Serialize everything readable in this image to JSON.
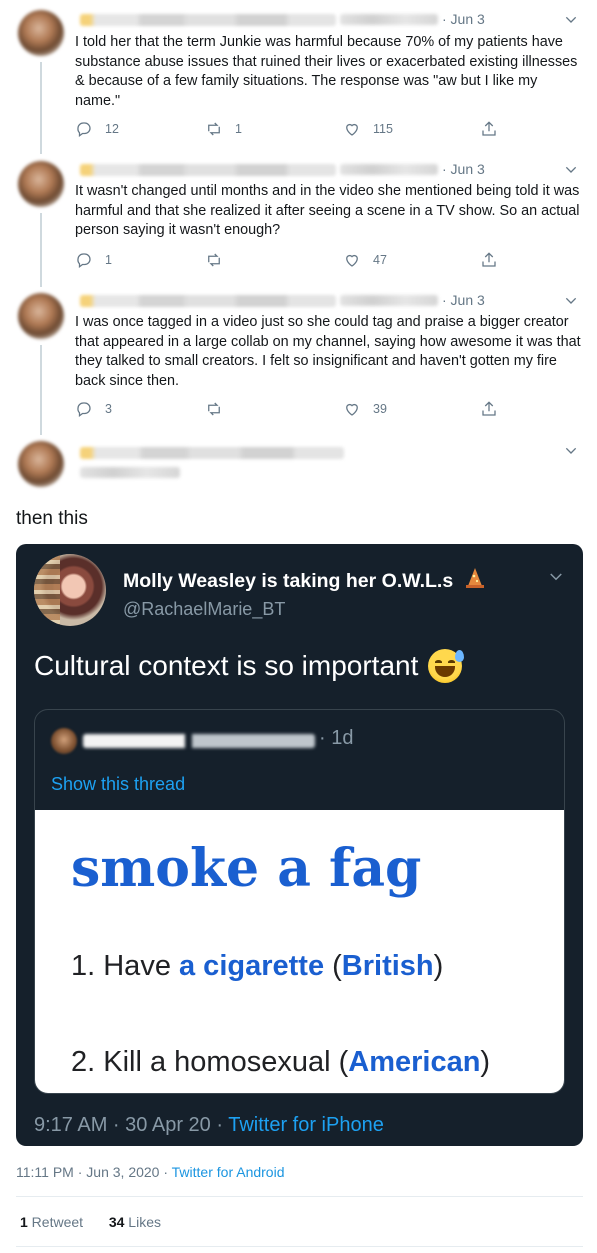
{
  "replies": [
    {
      "date": "· Jun 3",
      "text": "I told her that the term Junkie was harmful because 70% of my patients have substance abuse issues that ruined their lives or exacerbated existing illnesses & because of a few family situations. The response was \"aw but I like my name.\"",
      "replies": "12",
      "retweets": "1",
      "likes": "115"
    },
    {
      "date": "· Jun 3",
      "text": "It wasn't changed until months and in the video she mentioned being told it was harmful and that she realized it after seeing a scene in a TV show. So an actual person saying it wasn't enough?",
      "replies": "1",
      "retweets": "",
      "likes": "47"
    },
    {
      "date": "· Jun 3",
      "text": "I was once tagged in a video just so she could tag and praise a bigger creator that appeared in a large collab on my channel, saying how awesome it was that they talked to small creators. I felt so insignificant and haven't gotten my fire back since then.",
      "replies": "3",
      "retweets": "",
      "likes": "39"
    }
  ],
  "main_text": "then this",
  "embed": {
    "name": "Molly Weasley is taking her O.W.L.s",
    "handle": "@RachaelMarie_BT",
    "text": "Cultural context is so important",
    "quote": {
      "date": "· 1d",
      "show_thread": "Show this thread",
      "image": {
        "title": "smoke a fag",
        "def1_prefix": "1. Have ",
        "def1_bold": "a cigarette",
        "def1_mid": " (",
        "def1_region": "British",
        "def1_end": ")",
        "def2_prefix": "2. Kill a homosexual (",
        "def2_region": "American",
        "def2_end": ")"
      }
    },
    "footer_time": "9:17 AM · 30 Apr 20 · ",
    "footer_source": "Twitter for iPhone"
  },
  "meta": {
    "time": "11:11 PM · Jun 3, 2020 · ",
    "source": "Twitter for Android"
  },
  "stats": {
    "retweets_count": "1",
    "retweets_label": " Retweet",
    "likes_count": "34",
    "likes_label": " Likes"
  },
  "colors": {
    "link": "#1b95e0",
    "dark_bg": "#15202b",
    "definition_blue": "#1a5fd0"
  },
  "icons": [
    "reply-icon",
    "retweet-icon",
    "like-icon",
    "share-icon",
    "chevron-down-icon",
    "sweat-smile-emoji",
    "wizard-hat-emoji"
  ]
}
